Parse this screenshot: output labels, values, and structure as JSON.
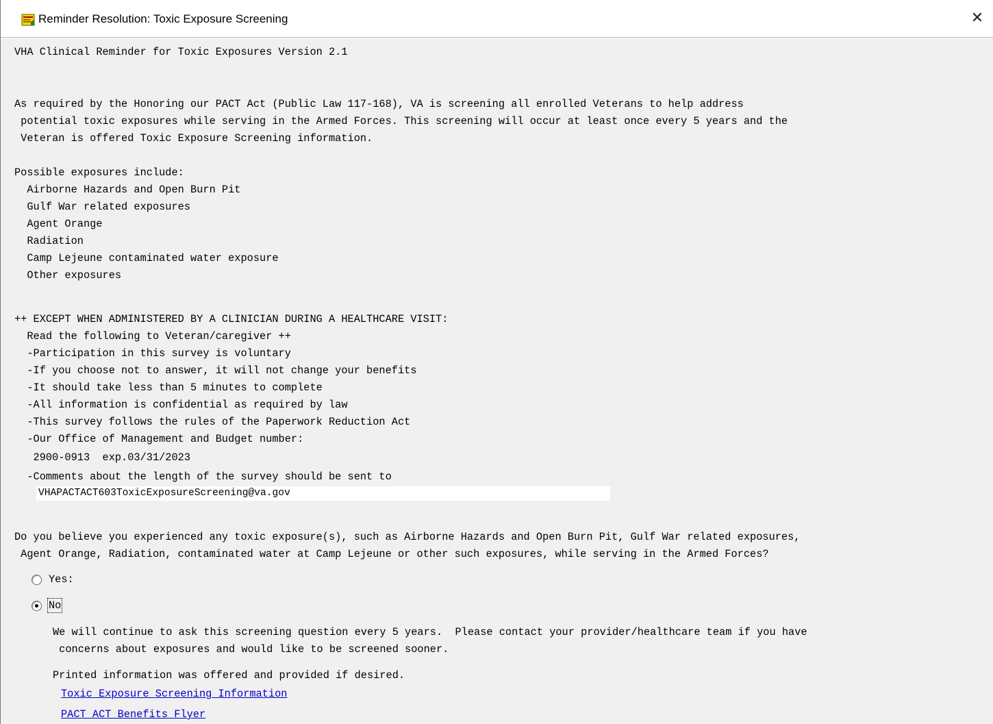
{
  "window": {
    "title": "Reminder Resolution: Toxic Exposure Screening",
    "close_label": "✕"
  },
  "content": {
    "heading": "VHA Clinical Reminder for Toxic Exposures Version 2.1",
    "intro": [
      "As required by the Honoring our PACT Act (Public Law 117-168), VA is screening all enrolled Veterans to help address",
      " potential toxic exposures while serving in the Armed Forces. This screening will occur at least once every 5 years and the",
      " Veteran is offered Toxic Exposure Screening information."
    ],
    "exposures_header": "Possible exposures include:",
    "exposures": [
      "  Airborne Hazards and Open Burn Pit",
      "  Gulf War related exposures",
      "  Agent Orange",
      "  Radiation",
      "  Camp Lejeune contaminated water exposure",
      "  Other exposures"
    ],
    "except": [
      "++ EXCEPT WHEN ADMINISTERED BY A CLINICIAN DURING A HEALTHCARE VISIT:",
      "  Read the following to Veteran/caregiver ++",
      "  -Participation in this survey is voluntary",
      "  -If you choose not to answer, it will not change your benefits",
      "  -It should take less than 5 minutes to complete",
      "  -All information is confidential as required by law",
      "  -This survey follows the rules of the Paperwork Reduction Act",
      "  -Our Office of Management and Budget number:",
      "   2900-0913  exp.03/31/2023",
      "  -Comments about the length of the survey should be sent to"
    ],
    "email": "VHAPACTACT603ToxicExposureScreening@va.gov",
    "question": [
      "Do you believe you experienced any toxic exposure(s), such as Airborne Hazards and Open Burn Pit, Gulf War related exposures,",
      " Agent Orange, Radiation, contaminated water at Camp Lejeune or other such exposures, while serving in the Armed Forces?"
    ],
    "options": {
      "yes_label": "Yes:",
      "no_label": "No",
      "selected": "No"
    },
    "no_followup": [
      "We will continue to ask this screening question every 5 years.  Please contact your provider/healthcare team if you have",
      " concerns about exposures and would like to be screened sooner."
    ],
    "printed_info": "Printed information was offered and provided if desired.",
    "links": {
      "screening_info": "Toxic Exposure Screening Information",
      "benefits_flyer": "PACT ACT Benefits Flyer"
    }
  }
}
